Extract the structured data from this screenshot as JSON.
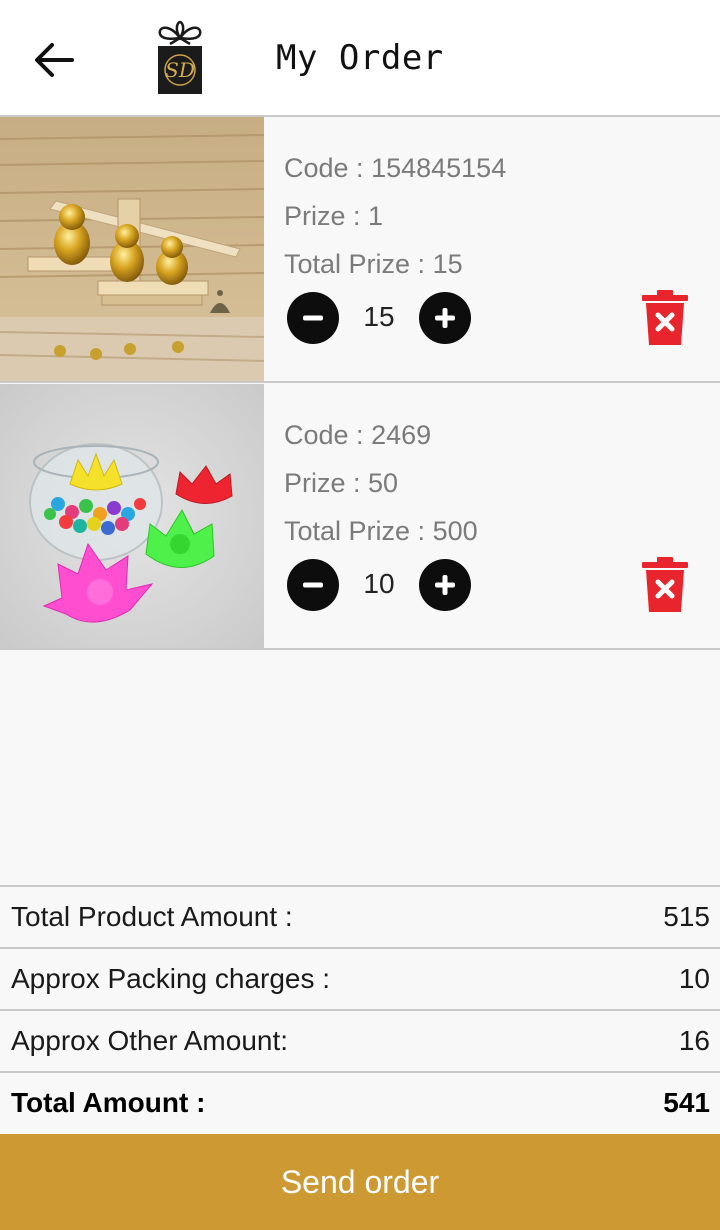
{
  "header": {
    "title": "My Order",
    "back_icon": "arrow-left-icon",
    "logo_text": "SD"
  },
  "items": [
    {
      "code_label": "Code : ",
      "code": "154845154",
      "prize_label": "Prize : ",
      "prize": "1",
      "total_label": "Total Prize : ",
      "total": "15",
      "quantity": "15"
    },
    {
      "code_label": "Code : ",
      "code": "2469",
      "prize_label": "Prize : ",
      "prize": "50",
      "total_label": "Total Prize : ",
      "total": "500",
      "quantity": "10"
    }
  ],
  "summary": {
    "product_label": "Total Product Amount :",
    "product_value": "515",
    "packing_label": "Approx Packing charges :",
    "packing_value": "10",
    "other_label": "Approx Other Amount:",
    "other_value": "16",
    "total_label": "Total Amount :",
    "total_value": "541"
  },
  "send_button": {
    "label": "Send order"
  },
  "colors": {
    "accent": "#cc9933",
    "delete": "#e8242c",
    "qty_button": "#0d0d0d",
    "info_text": "#7b7b7b"
  }
}
